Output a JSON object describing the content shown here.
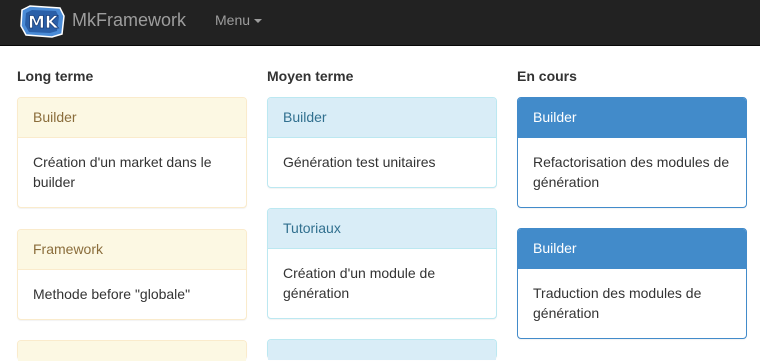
{
  "navbar": {
    "brand": "MkFramework",
    "menu_label": "Menu",
    "logo_text": "MK"
  },
  "columns": [
    {
      "title": "Long terme",
      "panels": [
        {
          "heading": "Builder",
          "body": "Création d'un market dans le builder"
        },
        {
          "heading": "Framework",
          "body": "Methode before \"globale\""
        }
      ]
    },
    {
      "title": "Moyen terme",
      "panels": [
        {
          "heading": "Builder",
          "body": "Génération test unitaires"
        },
        {
          "heading": "Tutoriaux",
          "body": "Création d'un module de génération"
        }
      ]
    },
    {
      "title": "En cours",
      "panels": [
        {
          "heading": "Builder",
          "body": "Refactorisation des modules de génération"
        },
        {
          "heading": "Builder",
          "body": "Traduction des modules de génération"
        }
      ]
    }
  ],
  "colors": {
    "navbar_bg": "#222222",
    "warning_heading_bg": "#fcf8e3",
    "info_heading_bg": "#d9edf7",
    "primary_heading_bg": "#428bca"
  }
}
